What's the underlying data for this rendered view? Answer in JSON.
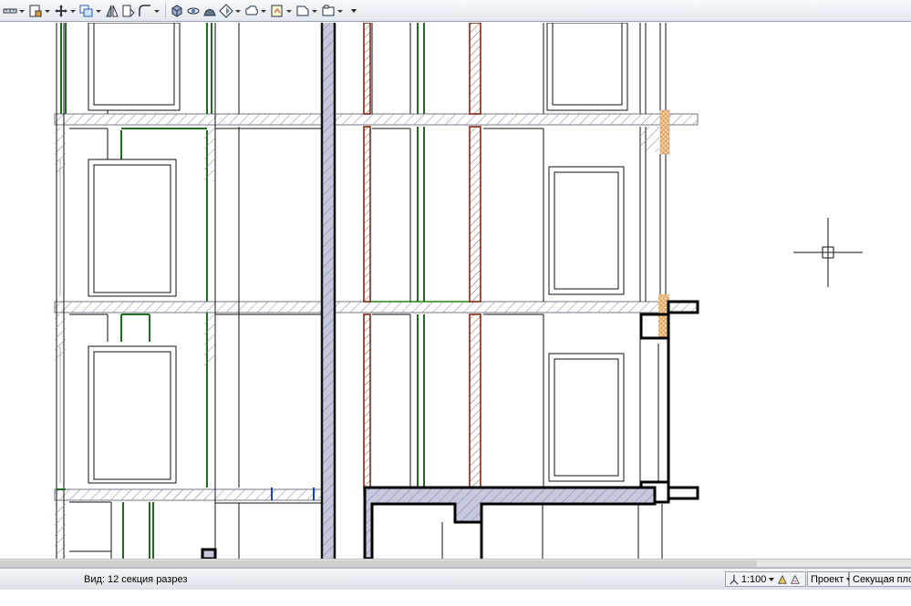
{
  "toolbar": {
    "buttons": [
      {
        "name": "measure-icon",
        "has_dropdown": true
      },
      {
        "name": "layer-properties-icon",
        "has_dropdown": true
      },
      {
        "name": "move-icon",
        "has_dropdown": true
      },
      {
        "name": "copy-icon",
        "has_dropdown": true
      },
      {
        "name": "mirror-icon",
        "has_dropdown": false
      },
      {
        "name": "rotate-icon",
        "has_dropdown": false
      },
      {
        "name": "fillet-icon",
        "has_dropdown": true
      },
      {
        "name": "view-cube-icon",
        "has_dropdown": false
      },
      {
        "name": "orbit-icon",
        "has_dropdown": false
      },
      {
        "name": "walk-icon",
        "has_dropdown": false
      },
      {
        "name": "render-icon",
        "has_dropdown": true
      },
      {
        "name": "cloud-icon",
        "has_dropdown": true
      },
      {
        "name": "annotate-icon",
        "has_dropdown": true
      },
      {
        "name": "shape-icon",
        "has_dropdown": true
      },
      {
        "name": "frame-icon",
        "has_dropdown": true
      }
    ]
  },
  "status": {
    "view_label": "Вид: 12 секция разрез",
    "scale": "1:100",
    "mode": "Проект",
    "plane": "Секущая плоско"
  },
  "colors": {
    "wall_green": "#1f6e1f",
    "wall_brown": "#7a1a0a",
    "hatch_blue": "#6a78b8",
    "column_fill": "#c6c9dc",
    "insulation": "#e8b070",
    "accent_blue": "#1a3fd0"
  }
}
